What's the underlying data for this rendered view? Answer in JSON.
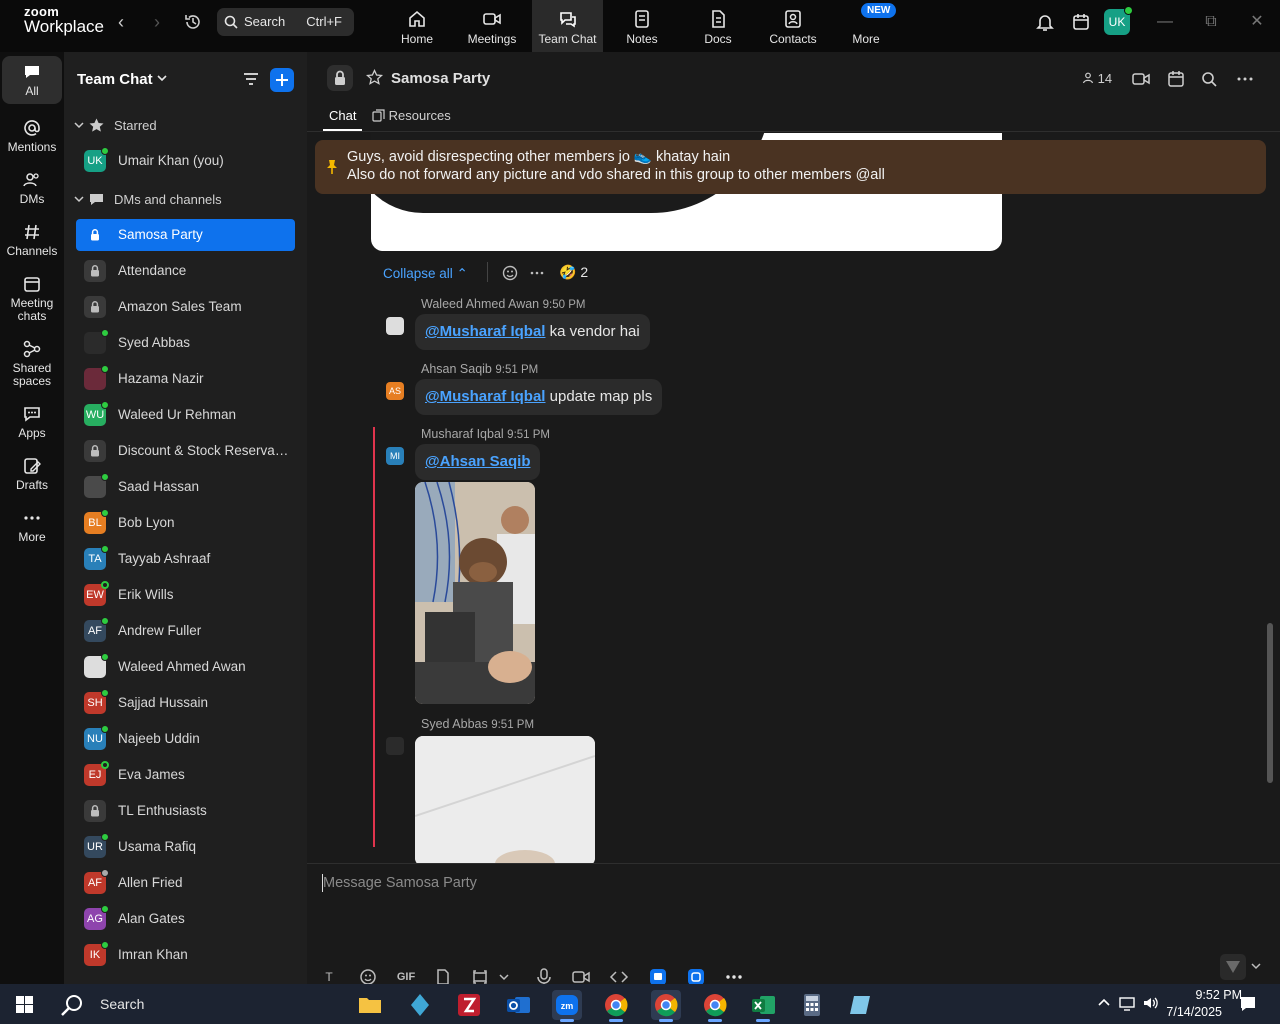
{
  "app": {
    "logo_line1": "zoom",
    "logo_line2": "Workplace",
    "search_label": "Search",
    "search_shortcut": "Ctrl+F",
    "user_initials": "UK",
    "new_badge": "NEW",
    "nav_tabs": [
      {
        "label": "Home",
        "icon": "home-icon"
      },
      {
        "label": "Meetings",
        "icon": "video-icon"
      },
      {
        "label": "Team Chat",
        "icon": "chat-icon"
      },
      {
        "label": "Notes",
        "icon": "notes-icon"
      },
      {
        "label": "Docs",
        "icon": "docs-icon"
      },
      {
        "label": "Contacts",
        "icon": "contacts-icon"
      },
      {
        "label": "More",
        "icon": "more-icon"
      }
    ],
    "active_tab": "Team Chat"
  },
  "rail": {
    "items": [
      {
        "label": "All",
        "icon": "chat-bubble-icon"
      },
      {
        "label": "Mentions",
        "icon": "at-icon"
      },
      {
        "label": "DMs",
        "icon": "people-icon"
      },
      {
        "label": "Channels",
        "icon": "hash-icon"
      },
      {
        "label": "Meeting chats",
        "icon": "calendar-icon"
      },
      {
        "label": "Shared spaces",
        "icon": "share-icon"
      },
      {
        "label": "Apps",
        "icon": "apps-icon"
      },
      {
        "label": "Drafts",
        "icon": "drafts-icon"
      },
      {
        "label": "More",
        "icon": "more-icon"
      }
    ]
  },
  "sidebar": {
    "title": "Team Chat",
    "section_starred": "Starred",
    "section_dms": "DMs and channels",
    "starred": [
      {
        "name": "Umair Khan (you)",
        "initials": "UK",
        "color": "#16a085",
        "presence": "online"
      }
    ],
    "items": [
      {
        "name": "Samosa Party",
        "type": "lock",
        "active": true
      },
      {
        "name": "Attendance",
        "type": "lock"
      },
      {
        "name": "Amazon Sales Team",
        "type": "lock"
      },
      {
        "name": "Syed Abbas",
        "initials": "",
        "color": "#2b2b2b",
        "presence": "online",
        "photo": true
      },
      {
        "name": "Hazama Nazir",
        "initials": "",
        "color": "#6b2a3a",
        "presence": "online",
        "photo": true
      },
      {
        "name": "Waleed Ur Rehman",
        "initials": "WU",
        "color": "#27ae60",
        "presence": "online"
      },
      {
        "name": "Discount & Stock Reservati...",
        "type": "lock"
      },
      {
        "name": "Saad Hassan",
        "initials": "",
        "color": "#4a4a4a",
        "presence": "online",
        "photo": true
      },
      {
        "name": "Bob Lyon",
        "initials": "BL",
        "color": "#e67e22",
        "presence": "online"
      },
      {
        "name": "Tayyab Ashraaf",
        "initials": "TA",
        "color": "#2980b9",
        "presence": "online"
      },
      {
        "name": "Erik Wills",
        "initials": "EW",
        "color": "#c0392b",
        "presence": "ring"
      },
      {
        "name": "Andrew Fuller",
        "initials": "AF",
        "color": "#34495e",
        "presence": "online"
      },
      {
        "name": "Waleed Ahmed Awan",
        "initials": "",
        "color": "#ddd",
        "presence": "online",
        "photo": true
      },
      {
        "name": "Sajjad Hussain",
        "initials": "SH",
        "color": "#c0392b",
        "presence": "online"
      },
      {
        "name": "Najeeb Uddin",
        "initials": "NU",
        "color": "#2980b9",
        "presence": "online"
      },
      {
        "name": "Eva James",
        "initials": "EJ",
        "color": "#c0392b",
        "presence": "ring"
      },
      {
        "name": "TL Enthusiasts",
        "type": "lock"
      },
      {
        "name": "Usama Rafiq",
        "initials": "UR",
        "color": "#34495e",
        "presence": "online"
      },
      {
        "name": "Allen Fried",
        "initials": "AF",
        "color": "#c0392b",
        "presence": "away"
      },
      {
        "name": "Alan Gates",
        "initials": "AG",
        "color": "#8e44ad",
        "presence": "online"
      },
      {
        "name": "Imran Khan",
        "initials": "IK",
        "color": "#c0392b",
        "presence": "online"
      }
    ]
  },
  "channel": {
    "name": "Samosa Party",
    "member_count": "14",
    "tabs": [
      "Chat",
      "Resources"
    ],
    "pinned_line1": "Guys, avoid disrespecting other members jo 👟 khatay hain",
    "pinned_line2": "Also do not forward any picture and vdo shared in this group to other members @all",
    "collapse_label": "Collapse all",
    "reaction_emoji": "🤣",
    "reaction_count": "2",
    "messages": [
      {
        "sender": "Waleed Ahmed Awan",
        "time": "9:50 PM",
        "mention": "@Musharaf Iqbal",
        "text": " ka vendor hai",
        "initials": "",
        "color": "#ddd"
      },
      {
        "sender": "Ahsan Saqib",
        "time": "9:51 PM",
        "mention": "@Musharaf Iqbal",
        "text": " update map pls",
        "initials": "AS",
        "color": "#e67e22"
      },
      {
        "sender": "Musharaf Iqbal",
        "time": "9:51 PM",
        "mention": "@Ahsan Saqib",
        "text": "",
        "initials": "MI",
        "color": "#2980b9"
      },
      {
        "sender": "Syed Abbas",
        "time": "9:51 PM",
        "mention": "",
        "text": "",
        "initials": "",
        "color": "#2b2b2b"
      }
    ],
    "composer_placeholder": "Message Samosa Party",
    "composer_tools": [
      "format-icon",
      "emoji-icon",
      "GIF",
      "file-icon",
      "screenshot-icon",
      "dropdown-icon",
      "mic-icon",
      "video-clip-icon",
      "code-icon",
      "app-icon-1",
      "app-icon-2",
      "more-icon"
    ]
  },
  "taskbar": {
    "search_label": "Search",
    "time": "9:52 PM",
    "date": "7/14/2025"
  },
  "colors": {
    "accent": "#0e72ed",
    "mention": "#4aa3ff",
    "pinned_bg": "#4a3322",
    "online": "#2ecc40",
    "unread_line": "#e0344d"
  }
}
